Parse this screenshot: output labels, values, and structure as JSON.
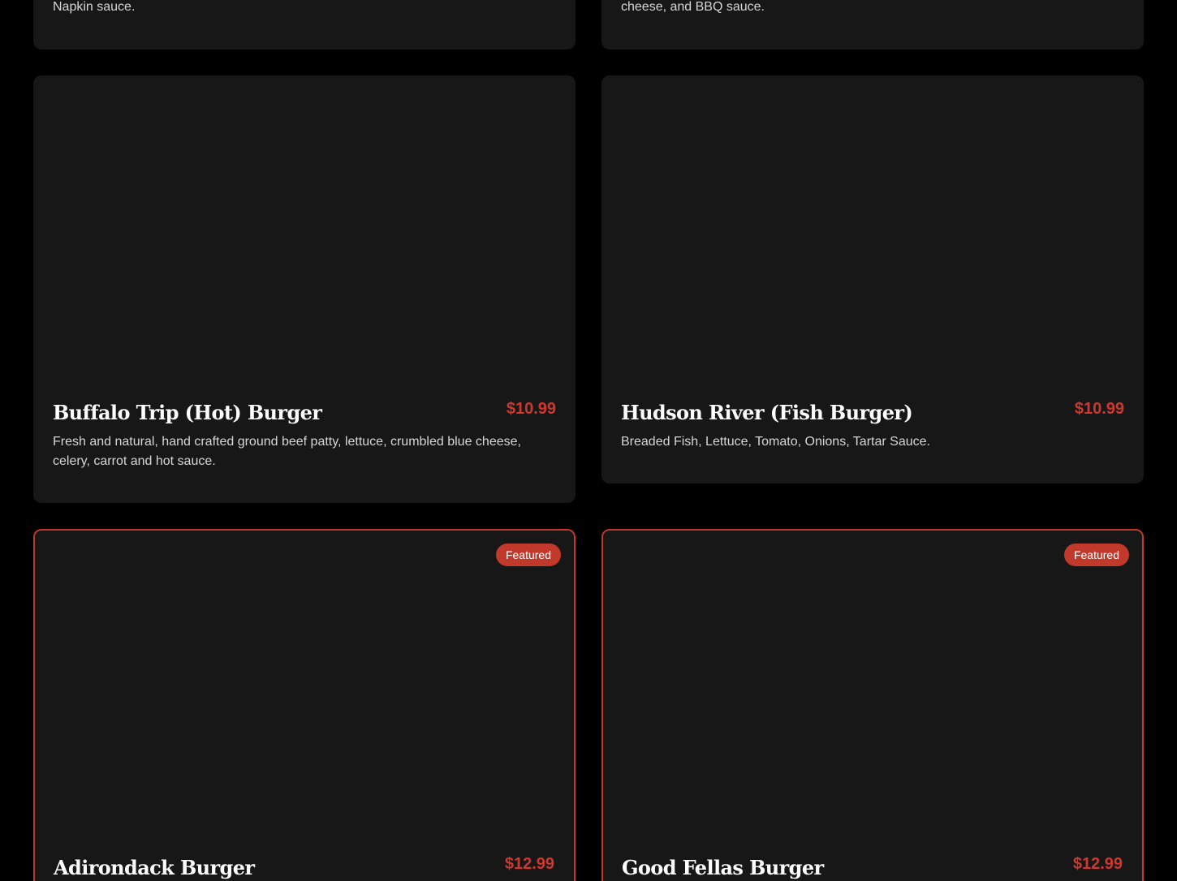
{
  "menu_items": [
    {
      "description_partial": "Napkin sauce."
    },
    {
      "description_partial": "cheese, and BBQ sauce."
    },
    {
      "name": "Buffalo Trip (Hot) Burger",
      "price": "$10.99",
      "description": "Fresh and natural, hand crafted ground beef patty, lettuce, crumbled blue cheese, celery, carrot and hot sauce."
    },
    {
      "name": "Hudson River (Fish Burger)",
      "price": "$10.99",
      "description": "Breaded Fish, Lettuce, Tomato, Onions, Tartar Sauce."
    },
    {
      "name": "Adirondack Burger",
      "price": "$12.99",
      "badge": "Featured"
    },
    {
      "name": "Good Fellas Burger",
      "price": "$12.99",
      "badge": "Featured"
    }
  ],
  "colors": {
    "page_background": "#000000",
    "card_background": "#171717",
    "accent_red": "#c0392b",
    "price_red": "#d0372d",
    "text_primary": "#ffffff",
    "text_secondary": "#d6d6d6"
  }
}
